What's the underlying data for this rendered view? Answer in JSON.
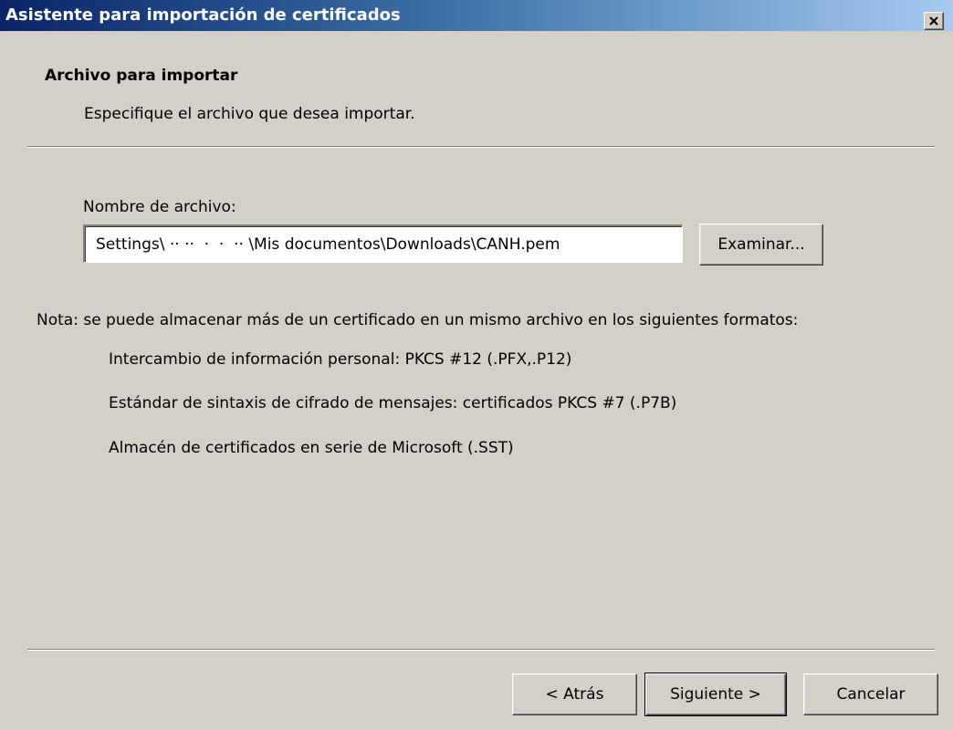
{
  "window": {
    "title": "Asistente para importación de certificados",
    "close_icon": "close-icon"
  },
  "header": {
    "title": "Archivo para importar",
    "subtitle": "Especifique el archivo que desea importar."
  },
  "file": {
    "label": "Nombre de archivo:",
    "value": "Settings\\ ·· ··  ·  ·  ·· \\Mis documentos\\Downloads\\CANH.pem",
    "browse_label": "Examinar..."
  },
  "note": {
    "text": "Nota: se puede almacenar más de un certificado en un mismo archivo en los siguientes formatos:",
    "formats": [
      "Intercambio de información personal: PKCS #12 (.PFX,.P12)",
      "Estándar de sintaxis de cifrado de mensajes: certificados PKCS #7 (.P7B)",
      "Almacén de certificados en serie de Microsoft (.SST)"
    ]
  },
  "footer": {
    "back_label": "< Atrás",
    "next_label": "Siguiente >",
    "cancel_label": "Cancelar"
  },
  "colors": {
    "title_start": "#0a246a",
    "title_end": "#a6caf0",
    "face": "#d4d0c8"
  }
}
